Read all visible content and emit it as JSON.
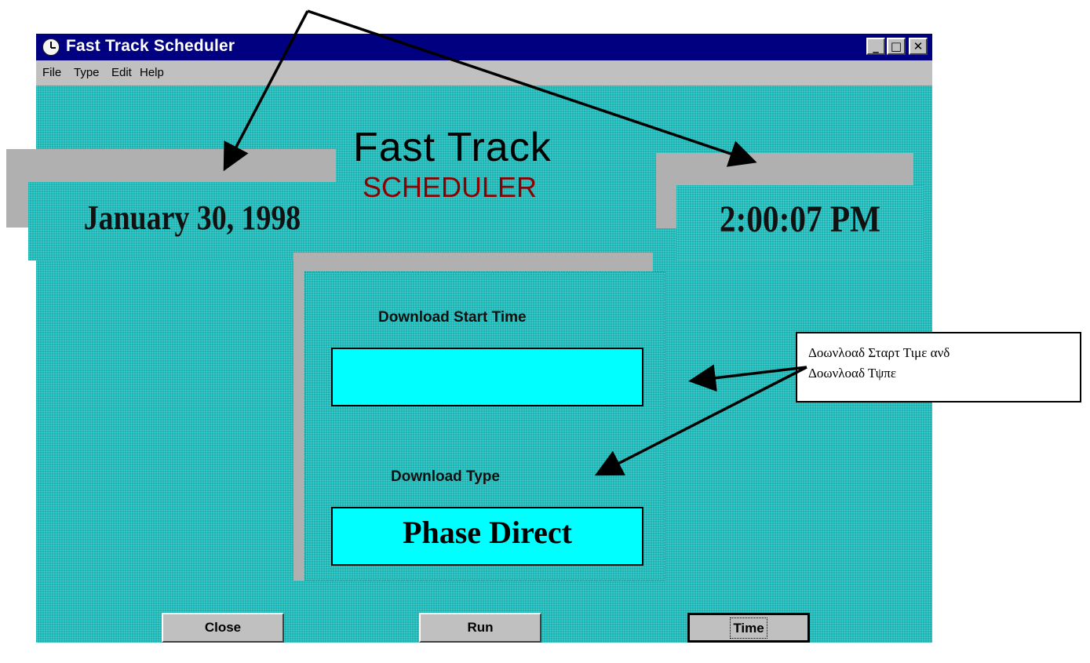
{
  "window": {
    "title": "Fast Track Scheduler",
    "controls": {
      "minimize": "_",
      "maximize": "ѧ",
      "close": "×"
    }
  },
  "menu": [
    "File",
    "Type",
    "Edit",
    "Help"
  ],
  "brand": {
    "line1": "Fast  Track",
    "line2": "SCHEDULER"
  },
  "date": "January 30, 1998",
  "time": "2:00:07 PM",
  "download": {
    "start_time_label": "Download Start Time",
    "start_time_value": "",
    "type_label": "Download Type",
    "type_value": "Phase Direct"
  },
  "buttons": {
    "close": "Close",
    "run": "Run",
    "time": "Time"
  },
  "annotation": {
    "line1": "Δοωνλοαδ Σταρτ Τιμε ανδ",
    "line2": "Δοωνλοαδ Τψπε"
  },
  "colors": {
    "title_bar": "#000080",
    "client": "#16b4b4",
    "field": "#00ffff",
    "scheduler": "#8b0000"
  }
}
